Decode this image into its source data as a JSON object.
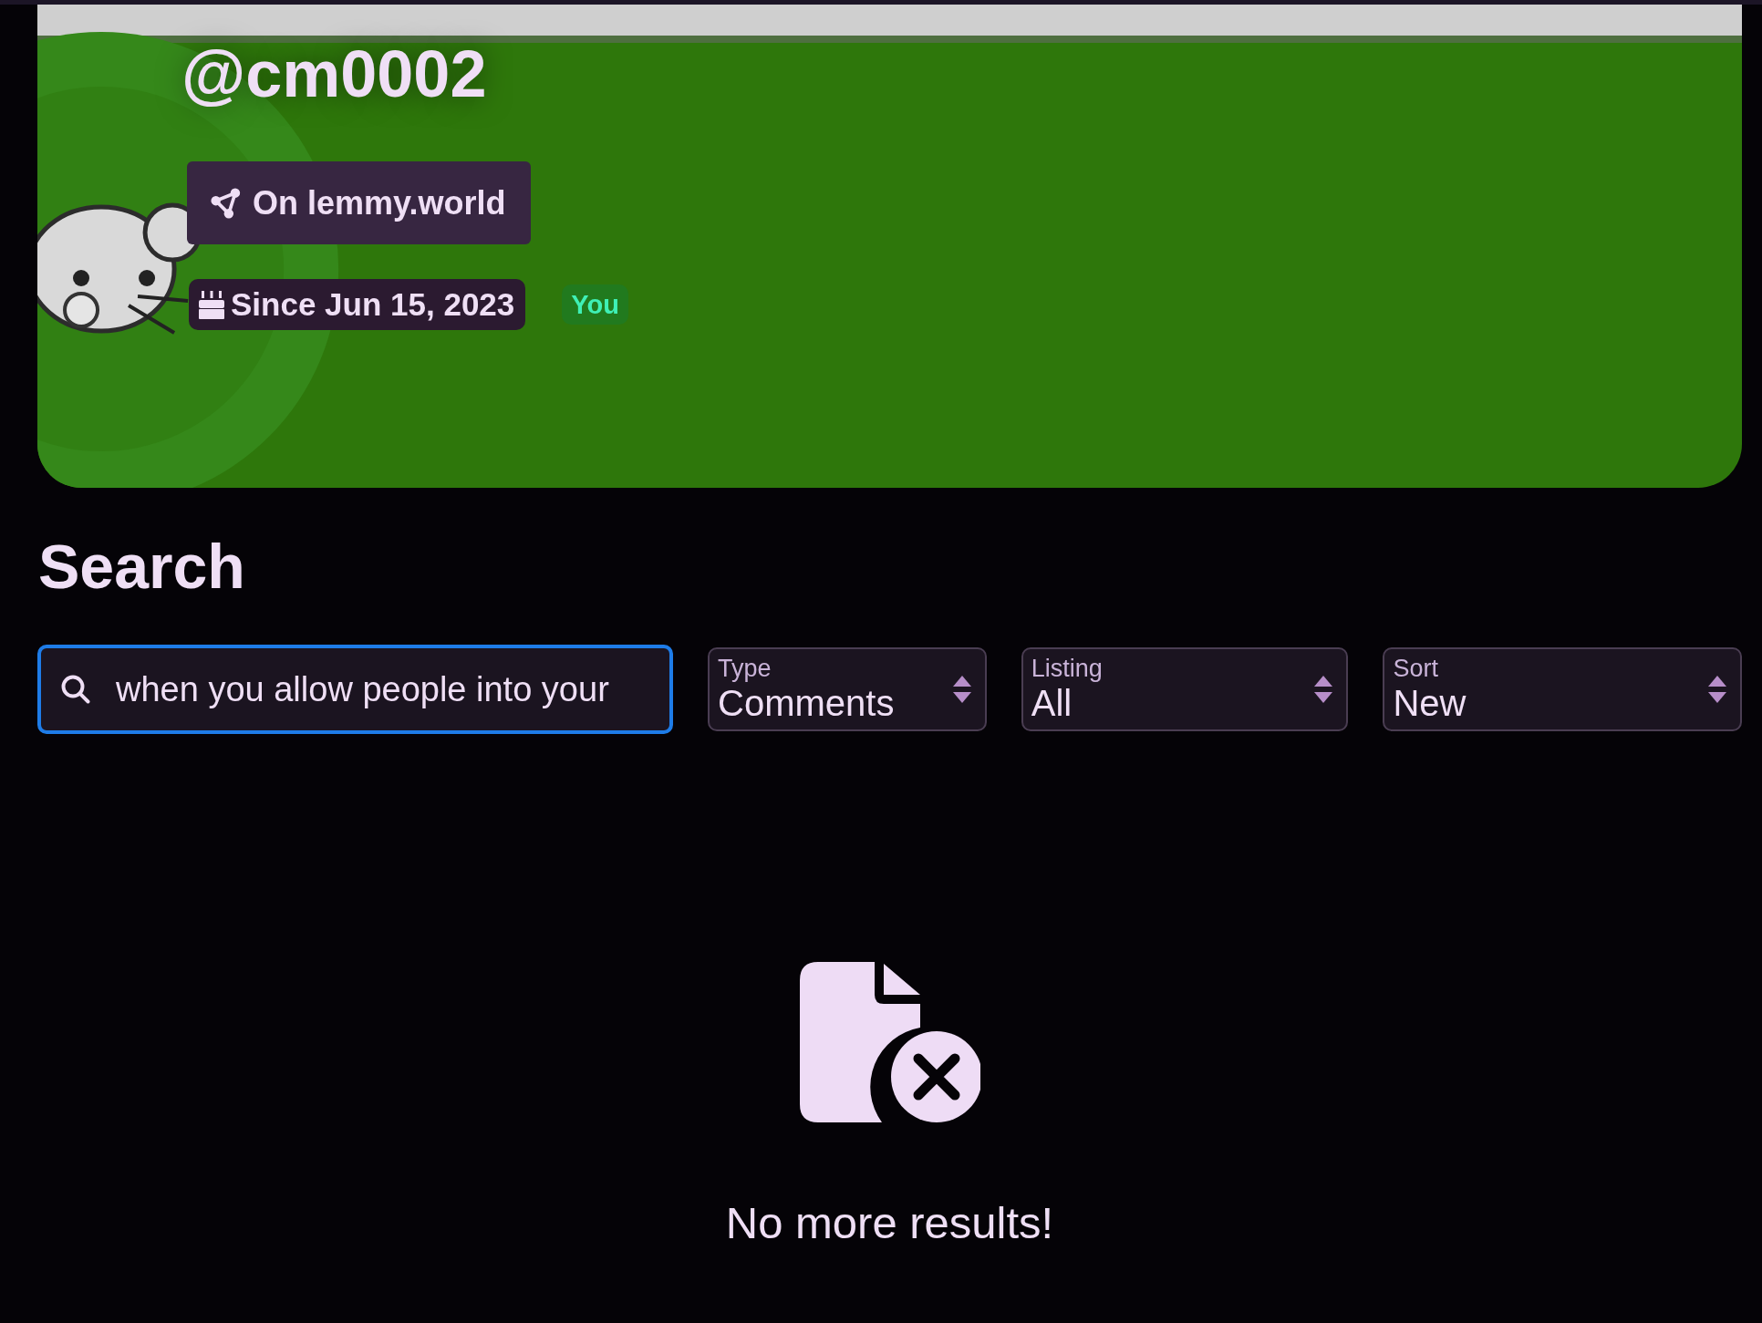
{
  "profile": {
    "username": "@cm0002",
    "instance_button": "On lemmy.world",
    "since_badge": "Since Jun 15, 2023",
    "you_badge": "You"
  },
  "search": {
    "heading": "Search",
    "query": "when you allow people into your",
    "focused": true,
    "selects": [
      {
        "label": "Type",
        "value": "Comments"
      },
      {
        "label": "Listing",
        "value": "All"
      },
      {
        "label": "Sort",
        "value": "New"
      }
    ]
  },
  "empty_state": {
    "message": "No more results!"
  }
}
